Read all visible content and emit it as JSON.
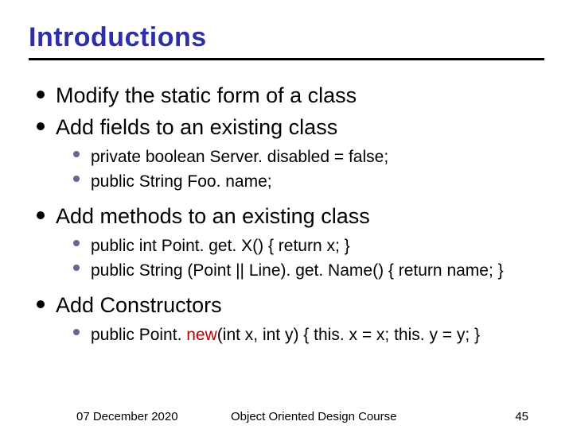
{
  "title": "Introductions",
  "bullets": [
    {
      "text": "Modify the static form of a class",
      "sub": []
    },
    {
      "text": "Add fields to an existing class",
      "sub": [
        {
          "text": "private boolean Server. disabled = false;"
        },
        {
          "text": "public String Foo. name;"
        }
      ]
    },
    {
      "text": "Add methods to an existing class",
      "sub": [
        {
          "text": "public int Point. get. X() { return x; }"
        },
        {
          "text": "public String (Point || Line). get. Name() { return name; }"
        }
      ]
    },
    {
      "text": "Add Constructors",
      "sub": [
        {
          "pre": "public Point. ",
          "keyword": "new",
          "post": "(int x, int y) { this. x = x; this. y = y; }"
        }
      ]
    }
  ],
  "footer": {
    "date": "07 December 2020",
    "course": "Object Oriented Design Course",
    "page": "45"
  }
}
